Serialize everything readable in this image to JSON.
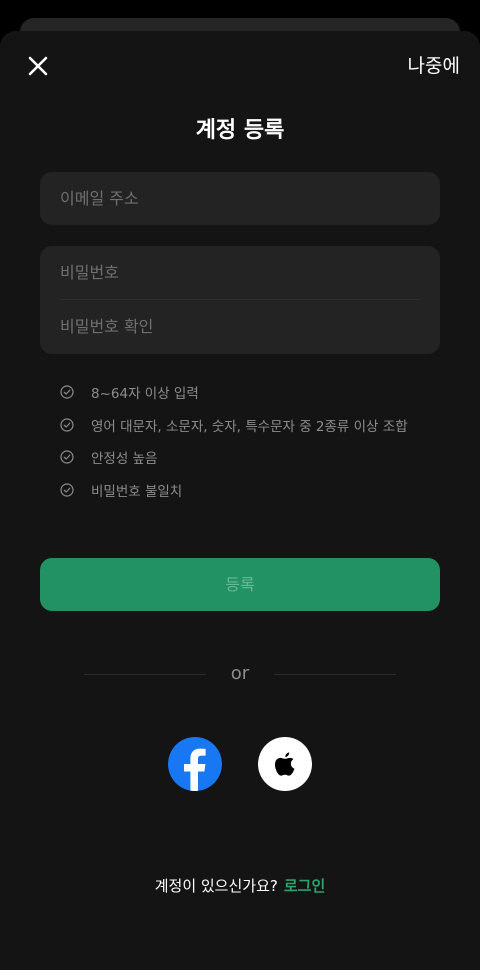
{
  "header": {
    "close_icon": "close-icon",
    "later_label": "나중에"
  },
  "title": "계정 등록",
  "form": {
    "email_placeholder": "이메일 주소",
    "password_placeholder": "비밀번호",
    "password_confirm_placeholder": "비밀번호 확인"
  },
  "rules": [
    {
      "icon": "check-circle-icon",
      "text": "8~64자 이상 입력"
    },
    {
      "icon": "check-circle-icon",
      "text": "영어 대문자, 소문자, 숫자, 특수문자 중 2종류 이상 조합"
    },
    {
      "icon": "check-circle-icon",
      "text": "안정성 높음"
    },
    {
      "icon": "check-circle-icon",
      "text": "비밀번호 불일치"
    }
  ],
  "register_label": "등록",
  "divider_text": "or",
  "social": {
    "facebook_icon": "facebook-icon",
    "apple_icon": "apple-icon"
  },
  "footer": {
    "question": "계정이 있으신가요?",
    "login_label": "로그인"
  },
  "colors": {
    "background": "#141414",
    "field_background": "#232323",
    "accent": "#229163",
    "link": "#27a36c",
    "facebook": "#1877f2"
  }
}
